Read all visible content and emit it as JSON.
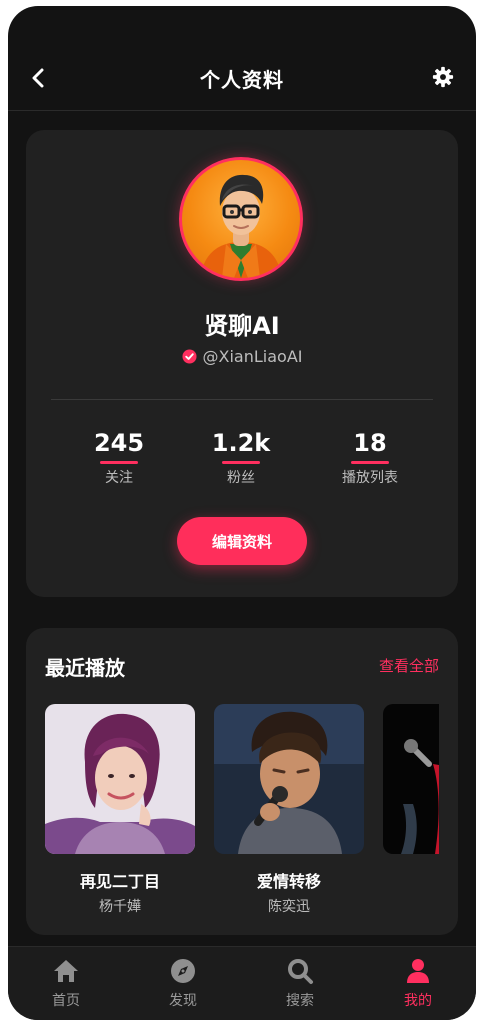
{
  "header": {
    "title": "个人资料"
  },
  "profile": {
    "name": "贤聊AI",
    "handle": "@XianLiaoAI",
    "stats": [
      {
        "value": "245",
        "label": "关注"
      },
      {
        "value": "1.2k",
        "label": "粉丝"
      },
      {
        "value": "18",
        "label": "播放列表"
      }
    ],
    "edit_label": "编辑资料"
  },
  "recent": {
    "title": "最近播放",
    "see_all": "查看全部",
    "tracks": [
      {
        "title": "再见二丁目",
        "artist": "杨千嬅"
      },
      {
        "title": "爱情转移",
        "artist": "陈奕迅"
      }
    ]
  },
  "nav": {
    "items": [
      {
        "label": "首页",
        "icon": "home-icon"
      },
      {
        "label": "发现",
        "icon": "compass-icon"
      },
      {
        "label": "搜索",
        "icon": "search-icon"
      },
      {
        "label": "我的",
        "icon": "user-icon"
      }
    ],
    "active": "我的"
  },
  "colors": {
    "accent": "#ff2f5f",
    "background": "#131313",
    "card": "#212121"
  }
}
